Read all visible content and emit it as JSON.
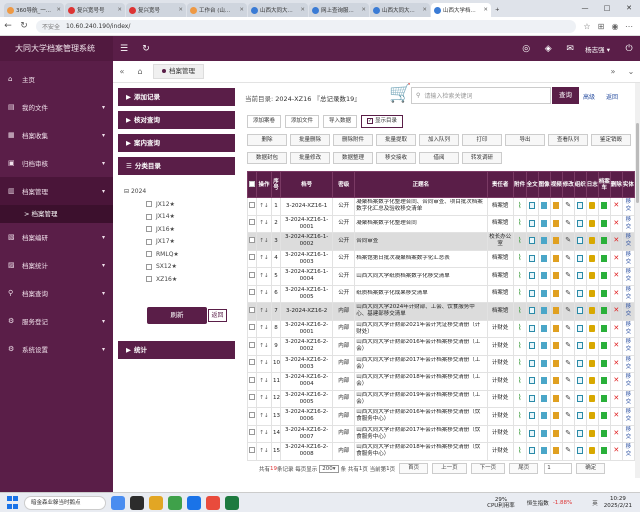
{
  "browser": {
    "tabs": [
      {
        "label": "360导航_一...",
        "active": false,
        "fav": "orange"
      },
      {
        "label": "复兴宽号号",
        "active": false,
        "fav": "red"
      },
      {
        "label": "复兴宽号",
        "active": false,
        "fav": "red"
      },
      {
        "label": "工作台 (山...",
        "active": false,
        "fav": "orange"
      },
      {
        "label": "山西大同大...",
        "active": false,
        "fav": "blue"
      },
      {
        "label": "网上查询服...",
        "active": false,
        "fav": "blue"
      },
      {
        "label": "山西大同大...",
        "active": false,
        "fav": "blue"
      },
      {
        "label": "山西大学档...",
        "active": true,
        "fav": "blue"
      }
    ],
    "url_warning": "不安全",
    "url": "10.60.240.190/index/"
  },
  "app": {
    "brand": "大同大学档案管理系统",
    "user": "杨志强",
    "menu": [
      {
        "icon": "home-icon",
        "glyph": "⌂",
        "label": "主页"
      },
      {
        "icon": "file-icon",
        "glyph": "▤",
        "label": "我的文件"
      },
      {
        "icon": "collect-icon",
        "glyph": "▦",
        "label": "档案收集"
      },
      {
        "icon": "archive-icon",
        "glyph": "▣",
        "label": "归档审核"
      },
      {
        "icon": "manage-icon",
        "glyph": "▥",
        "label": "档案管理"
      },
      {
        "icon": "edit-icon",
        "glyph": "▧",
        "label": "档案编研"
      },
      {
        "icon": "stats-icon",
        "glyph": "▨",
        "label": "档案统计"
      },
      {
        "icon": "query-icon",
        "glyph": "⚲",
        "label": "档案查询"
      },
      {
        "icon": "service-icon",
        "glyph": "⚙",
        "label": "服务登记"
      },
      {
        "icon": "system-icon",
        "glyph": "⚙",
        "label": "系统设置"
      }
    ],
    "submenu_active": "> 档案管理",
    "breadcrumb_tab": "档案管理"
  },
  "left_panel": {
    "add_record": "添加记录",
    "verify_query": "核对查询",
    "volume_query": "案内查询",
    "classify": "分类目录",
    "tree_root": "2024",
    "tree_children": [
      "JX12★",
      "JX14★",
      "JX16★",
      "JX17★",
      "RMLQ★",
      "SX12★",
      "XZ16★"
    ],
    "refresh": "刷新",
    "back": "返回",
    "stats": "统计"
  },
  "main": {
    "current_label": "当前目录:",
    "current_value": "2024-XZ16",
    "total": "『总记录数19』",
    "search_placeholder": "请输入检索关键词",
    "search_btn": "查询",
    "advanced": "高级",
    "return": "返回",
    "row1_buttons": [
      "添加案卷",
      "添加文件",
      "导入数据"
    ],
    "show_path": "显示目录",
    "row2_buttons": [
      "删除",
      "批量删除",
      "删除附件",
      "批量提取",
      "加入队列",
      "打印",
      "导出",
      "查看队列",
      "鉴定销毁"
    ],
    "row3_buttons": [
      "数据封包",
      "批量修改",
      "数据整理",
      "移交接收",
      "借阅",
      "转发调研"
    ]
  },
  "table": {
    "headers": [
      "",
      "操作",
      "序号",
      "档号",
      "密级",
      "正题名",
      "责任者",
      "附件",
      "全文",
      "图像",
      "视频",
      "修改",
      "组织",
      "日志",
      "档案车",
      "删除",
      "实体"
    ],
    "rows": [
      {
        "idx": "1",
        "code": "3-2024-XZ16-1",
        "level": "公开",
        "title": "凝聚档案数字化整理合同、合同审查、项目批次档案数字化汇总及验收移交清单",
        "owner": "档案馆",
        "sel": false
      },
      {
        "idx": "2",
        "code": "3-2024-XZ16-1-0001",
        "level": "公开",
        "title": "凝聚档案数字化整理合同",
        "owner": "档案馆",
        "sel": false
      },
      {
        "idx": "3",
        "code": "3-2024-XZ16-1-0002",
        "level": "公开",
        "title": "合同审查",
        "owner": "校长办公室",
        "sel": true
      },
      {
        "idx": "4",
        "code": "3-2024-XZ16-1-0003",
        "level": "公开",
        "title": "档案馆第日批次凝聚档案数字化汇总表",
        "owner": "档案馆",
        "sel": false
      },
      {
        "idx": "5",
        "code": "3-2024-XZ16-1-0004",
        "level": "公开",
        "title": "山西大同大学纸质档案数字化移交清单",
        "owner": "档案馆",
        "sel": false
      },
      {
        "idx": "6",
        "code": "3-2024-XZ16-1-0005",
        "level": "公开",
        "title": "纸质档案数字化成果移交清单",
        "owner": "档案馆",
        "sel": false
      },
      {
        "idx": "7",
        "code": "3-2024-XZ16-2",
        "level": "内部",
        "title": "山西大同大学2024年计财部、工会、饮食服务中心、基建部移交清单",
        "owner": "档案馆",
        "sel": true
      },
      {
        "idx": "8",
        "code": "3-2024-XZ16-2-0001",
        "level": "内部",
        "title": "山西大同大学计财部2021年会计凭证移交清册（计财处）",
        "owner": "计财处",
        "sel": false
      },
      {
        "idx": "9",
        "code": "3-2024-XZ16-2-0002",
        "level": "内部",
        "title": "山西大同大学计财部2016年会计档案移交清册（工会）",
        "owner": "计财处",
        "sel": false
      },
      {
        "idx": "10",
        "code": "3-2024-XZ16-2-0003",
        "level": "内部",
        "title": "山西大同大学计财部2017年会计档案移交清册（工会）",
        "owner": "计财处",
        "sel": false
      },
      {
        "idx": "11",
        "code": "3-2024-XZ16-2-0004",
        "level": "内部",
        "title": "山西大同大学计财部2018年会计档案移交清册（工会）",
        "owner": "计财处",
        "sel": false
      },
      {
        "idx": "12",
        "code": "3-2024-XZ16-2-0005",
        "level": "内部",
        "title": "山西大同大学计财部2019年会计档案移交清册（工会）",
        "owner": "计财处",
        "sel": false
      },
      {
        "idx": "13",
        "code": "3-2024-XZ16-2-0006",
        "level": "内部",
        "title": "山西大同大学计财部2016年会计档案移交清册（饮食服务中心）",
        "owner": "计财处",
        "sel": false
      },
      {
        "idx": "14",
        "code": "3-2024-XZ16-2-0007",
        "level": "内部",
        "title": "山西大同大学计财部2017年会计档案移交清册（饮食服务中心）",
        "owner": "计财处",
        "sel": false
      },
      {
        "idx": "15",
        "code": "3-2024-XZ16-2-0008",
        "level": "内部",
        "title": "山西大同大学计财部2018年会计档案移交清册（饮食服务中心）",
        "owner": "计财处",
        "sel": false
      }
    ]
  },
  "pager": {
    "total_pre": "共有",
    "total_num": "19",
    "total_post": "条记录",
    "per_page_label": "每页显示",
    "per_page": "200",
    "per_page_unit": "条",
    "page_pre": "共有",
    "page_num": "1",
    "page_post": "页",
    "current_pre": "当前第",
    "current_num": "1",
    "current_post": "页",
    "first": "首页",
    "prev": "上一页",
    "next": "下一页",
    "last": "尾页",
    "page_input": "1",
    "go": "确定"
  },
  "taskbar": {
    "search": "暗金森业躲当时鹅点",
    "cpu_pct": "29%",
    "cpu_label": "CPU利用率",
    "index_name": "恒生指数",
    "index_change": "-1.88%",
    "lang": "英",
    "time": "10:29",
    "date": "2025/2/21"
  }
}
